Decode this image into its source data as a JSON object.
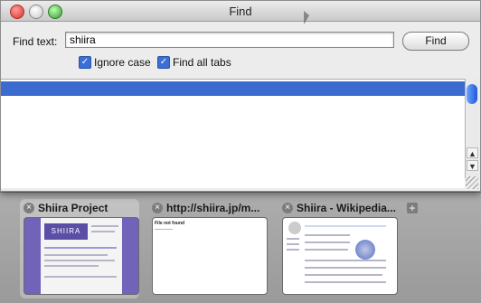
{
  "find_panel": {
    "title": "Find",
    "find_text_label": "Find text:",
    "find_text_value": "shiira",
    "find_button": "Find",
    "ignore_case_label": "Ignore case",
    "ignore_case_checked": true,
    "find_all_tabs_label": "Find all tabs",
    "find_all_tabs_checked": true
  },
  "tabs": [
    {
      "title": "Shiira Project",
      "selected": true
    },
    {
      "title": "http://shiira.jp/m...",
      "selected": false
    },
    {
      "title": "Shiira - Wikipedia...",
      "selected": false
    }
  ],
  "thumb_text": {
    "shiira_banner": "SHIIRA",
    "blank_page_heading": "File not found"
  },
  "colors": {
    "selection": "#3c6bd0",
    "checkbox": "#3a6fd6",
    "shiira_brand": "#7163b8"
  }
}
